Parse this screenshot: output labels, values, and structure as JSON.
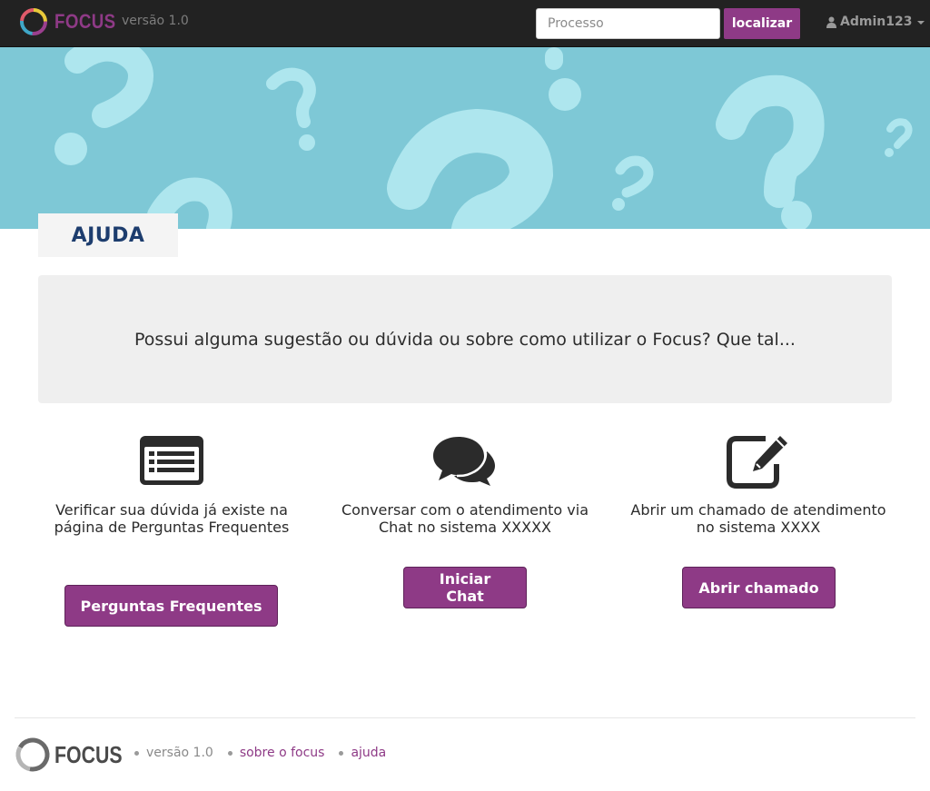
{
  "navbar": {
    "brand": "FOCUS",
    "version": "versão 1.0",
    "search_placeholder": "Processo",
    "search_button": "localizar",
    "user": "Admin123"
  },
  "page": {
    "title": "AJUDA",
    "intro": "Possui alguma sugestão ou dúvida ou sobre como utilizar o Focus? Que tal..."
  },
  "options": [
    {
      "icon": "list-icon",
      "text": "Verificar sua dúvida já existe na página de Perguntas Frequentes",
      "button": "Perguntas Frequentes"
    },
    {
      "icon": "chat-icon",
      "text": "Conversar com o atendimento via Chat no sistema XXXXX",
      "button": "Iniciar Chat"
    },
    {
      "icon": "edit-icon",
      "text": "Abrir um chamado de atendimento no sistema XXXX",
      "button": "Abrir chamado"
    }
  ],
  "footer": {
    "brand": "FOCUS",
    "version": "versão 1.0",
    "about_link": "sobre o focus",
    "help_link": "ajuda"
  },
  "colors": {
    "accent": "#8e3a86",
    "navbar": "#222222",
    "banner": "#7ec8d6",
    "title": "#1d3d6e"
  }
}
